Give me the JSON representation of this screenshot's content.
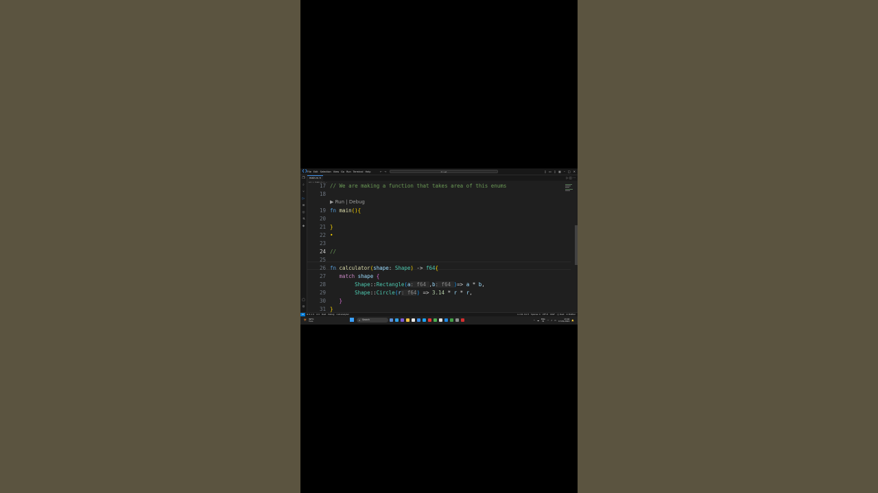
{
  "titlebar": {
    "menu": [
      "File",
      "Edit",
      "Selection",
      "View",
      "Go",
      "Run",
      "Terminal",
      "Help"
    ],
    "search_placeholder": "P rust"
  },
  "tabs": [
    {
      "label": "main.rs"
    }
  ],
  "breadcrumb": "src > main.rs > ...",
  "codelens": "▶ Run | Debug",
  "editor": {
    "active_line": 24,
    "lines": [
      17,
      18,
      19,
      20,
      21,
      22,
      23,
      24,
      25,
      26,
      27,
      28,
      29,
      30,
      31
    ]
  },
  "code": {
    "line17": "// We are making a function that takes area of this enums",
    "line23": "•",
    "line24": "//",
    "fn_kw": "fn",
    "main_name": "main",
    "calc_name": "calculator",
    "shape_param": "shape",
    "shape_type": "Shape",
    "ret_type": "f64",
    "match_kw": "match",
    "rect_variant": "Rectangle",
    "circle_variant": "Circle",
    "pi": "3.14"
  },
  "statusbar": {
    "left": [
      "⊗ 0 ⚠ 0",
      "⊘ 0",
      "Rust",
      "Debug",
      "rust-analyzer"
    ],
    "right": [
      "Ln 24, Col 3",
      "Spaces: 4",
      "UTF-8",
      "CRLF",
      "{} Rust",
      "⊘ Prettier"
    ]
  },
  "taskbar": {
    "weather_temp": "30°C",
    "weather_desc": "Haze",
    "search_label": "Search",
    "lang": "ENG\nIN",
    "time": "13:02",
    "date": "17-09-2024"
  },
  "colors": {
    "accent": "#0078d4",
    "comment": "#6a9955",
    "keyword": "#569cd6",
    "function": "#dcdcaa",
    "type": "#4ec9b0"
  }
}
